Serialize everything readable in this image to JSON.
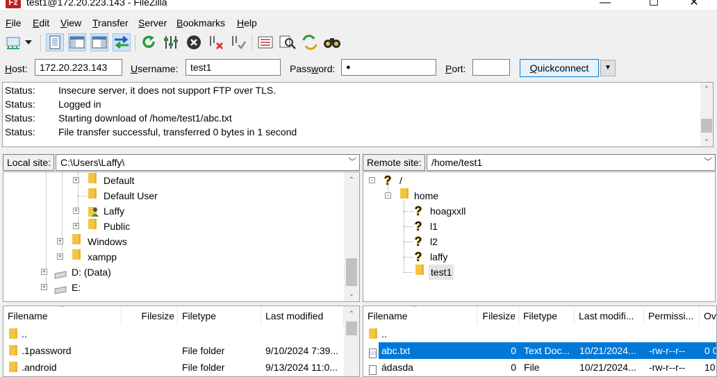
{
  "window": {
    "title": "test1@172.20.223.143 - FileZilla",
    "app_icon_text": "Fz",
    "minimize_glyph": "—",
    "maximize_glyph": "☐",
    "close_glyph": "✕"
  },
  "menu": [
    {
      "pre": "",
      "u": "F",
      "post": "ile"
    },
    {
      "pre": "",
      "u": "E",
      "post": "dit"
    },
    {
      "pre": "",
      "u": "V",
      "post": "iew"
    },
    {
      "pre": "",
      "u": "T",
      "post": "ransfer"
    },
    {
      "pre": "",
      "u": "S",
      "post": "erver"
    },
    {
      "pre": "",
      "u": "B",
      "post": "ookmarks"
    },
    {
      "pre": "",
      "u": "H",
      "post": "elp"
    }
  ],
  "toolbar": {
    "icons": [
      "site-manager-icon",
      "dropdown-arrow-icon",
      "toggle-message-log-icon",
      "toggle-local-tree-icon",
      "toggle-remote-tree-icon",
      "toggle-transfer-queue-icon",
      "refresh-icon",
      "process-queue-icon",
      "cancel-icon",
      "disconnect-icon",
      "reconnect-icon",
      "directory-listing-filters-icon",
      "toggle-comparison-icon",
      "synchronized-browsing-icon",
      "search-files-icon"
    ]
  },
  "quickconnect": {
    "host_label_u": "H",
    "host_label_rest": "ost:",
    "host_value": "172.20.223.143",
    "user_label_u": "U",
    "user_label_rest": "sername:",
    "user_value": "test1",
    "pass_label_pre": "Pass",
    "pass_label_u": "w",
    "pass_label_rest": "ord:",
    "pass_value": "●",
    "port_label_u": "P",
    "port_label_rest": "ort:",
    "port_value": "",
    "button_u": "Q",
    "button_rest": "uickconnect",
    "dropdown_glyph": "▼"
  },
  "log": [
    {
      "key": "Status:",
      "text": "Insecure server, it does not support FTP over TLS."
    },
    {
      "key": "Status:",
      "text": "Logged in"
    },
    {
      "key": "Status:",
      "text": "Starting download of /home/test1/abc.txt"
    },
    {
      "key": "Status:",
      "text": "File transfer successful, transferred 0 bytes in 1 second"
    }
  ],
  "local": {
    "site_label": "Local site:",
    "path": "C:\\Users\\Laffy\\",
    "tree": [
      {
        "label": "Default",
        "exp": "+",
        "icon": "folder"
      },
      {
        "label": "Default User",
        "exp": "",
        "icon": "folder"
      },
      {
        "label": "Laffy",
        "exp": "+",
        "icon": "user-folder"
      },
      {
        "label": "Public",
        "exp": "+",
        "icon": "folder"
      },
      {
        "label": "Windows",
        "exp": "+",
        "icon": "folder"
      },
      {
        "label": "xampp",
        "exp": "+",
        "icon": "folder"
      },
      {
        "label": "D: (Data)",
        "exp": "+",
        "icon": "drive"
      },
      {
        "label": "E:",
        "exp": "+",
        "icon": "drive"
      }
    ],
    "columns": [
      "Filename",
      "Filesize",
      "Filetype",
      "Last modified"
    ],
    "rows": [
      {
        "name": "..",
        "size": "",
        "type": "",
        "modified": ""
      },
      {
        "name": ".1password",
        "size": "",
        "type": "File folder",
        "modified": "9/10/2024 7:39..."
      },
      {
        "name": ".android",
        "size": "",
        "type": "File folder",
        "modified": "9/13/2024 11:0..."
      }
    ]
  },
  "remote": {
    "site_label": "Remote site:",
    "path": "/home/test1",
    "tree": [
      {
        "label": "/",
        "exp": "-",
        "icon": "question"
      },
      {
        "label": "home",
        "exp": "-",
        "icon": "folder"
      },
      {
        "label": "hoagxxll",
        "exp": "",
        "icon": "question"
      },
      {
        "label": "l1",
        "exp": "",
        "icon": "question"
      },
      {
        "label": "l2",
        "exp": "",
        "icon": "question"
      },
      {
        "label": "laffy",
        "exp": "",
        "icon": "question"
      },
      {
        "label": "test1",
        "exp": "",
        "icon": "folder"
      }
    ],
    "columns": [
      "Filename",
      "Filesize",
      "Filetype",
      "Last modifi...",
      "Permissi...",
      "Ov"
    ],
    "rows": [
      {
        "name": "..",
        "size": "",
        "type": "",
        "modified": "",
        "perm": "",
        "owner": ""
      },
      {
        "name": "abc.txt",
        "size": "0",
        "type": "Text Doc...",
        "modified": "10/21/2024...",
        "perm": "-rw-r--r--",
        "owner": "0 0"
      },
      {
        "name": "ádasda",
        "size": "0",
        "type": "File",
        "modified": "10/21/2024...",
        "perm": "-rw-r--r--",
        "owner": "10"
      }
    ]
  },
  "colors": {
    "selection": "#0078d7",
    "accent_button_border": "#0078d7",
    "folder": "#f5c443"
  }
}
